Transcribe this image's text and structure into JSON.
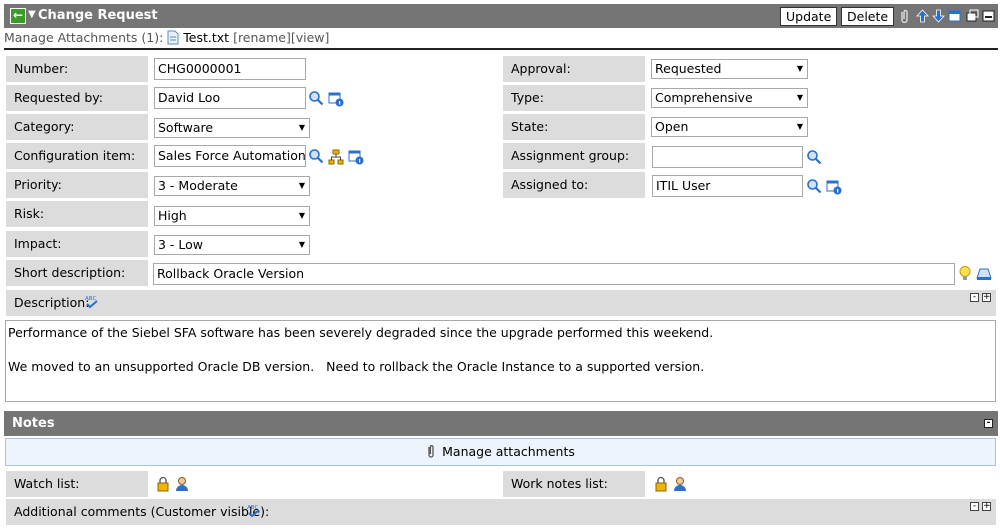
{
  "header": {
    "title": "Change Request",
    "update_label": "Update",
    "delete_label": "Delete"
  },
  "attachments": {
    "manage_label": "Manage Attachments (1):",
    "file_name": "Test.txt",
    "rename_label": "[rename]",
    "view_label": "[view]"
  },
  "form": {
    "number": {
      "label": "Number:",
      "value": "CHG0000001"
    },
    "requested_by": {
      "label": "Requested by:",
      "value": "David Loo"
    },
    "category": {
      "label": "Category:",
      "value": "Software"
    },
    "config_item": {
      "label": "Configuration item:",
      "value": "Sales Force Automation"
    },
    "priority": {
      "label": "Priority:",
      "value": "3 - Moderate"
    },
    "risk": {
      "label": "Risk:",
      "value": "High"
    },
    "impact": {
      "label": "Impact:",
      "value": "3 - Low"
    },
    "approval": {
      "label": "Approval:",
      "value": "Requested"
    },
    "type": {
      "label": "Type:",
      "value": "Comprehensive"
    },
    "state": {
      "label": "State:",
      "value": "Open"
    },
    "assignment_group": {
      "label": "Assignment group:",
      "value": ""
    },
    "assigned_to": {
      "label": "Assigned to:",
      "value": "ITIL User"
    },
    "short_description": {
      "label": "Short description:",
      "value": "Rollback Oracle Version"
    },
    "description": {
      "label": "Description:",
      "line1": "Performance of the Siebel SFA software has been severely degraded since the upgrade performed this weekend.",
      "line2": "We moved to an unsupported Oracle DB version.   Need to rollback the Oracle Instance to a supported version."
    }
  },
  "notes": {
    "title": "Notes",
    "manage_attachments": "Manage attachments",
    "watch_list": "Watch list:",
    "work_notes_list": "Work notes list:",
    "additional_comments": "Additional comments (Customer visible):"
  },
  "colors": {
    "header_bg": "#757575",
    "label_bg": "#dcdcdc",
    "accent_blue": "#2a6fc9",
    "back_green": "#3c9a2b"
  }
}
